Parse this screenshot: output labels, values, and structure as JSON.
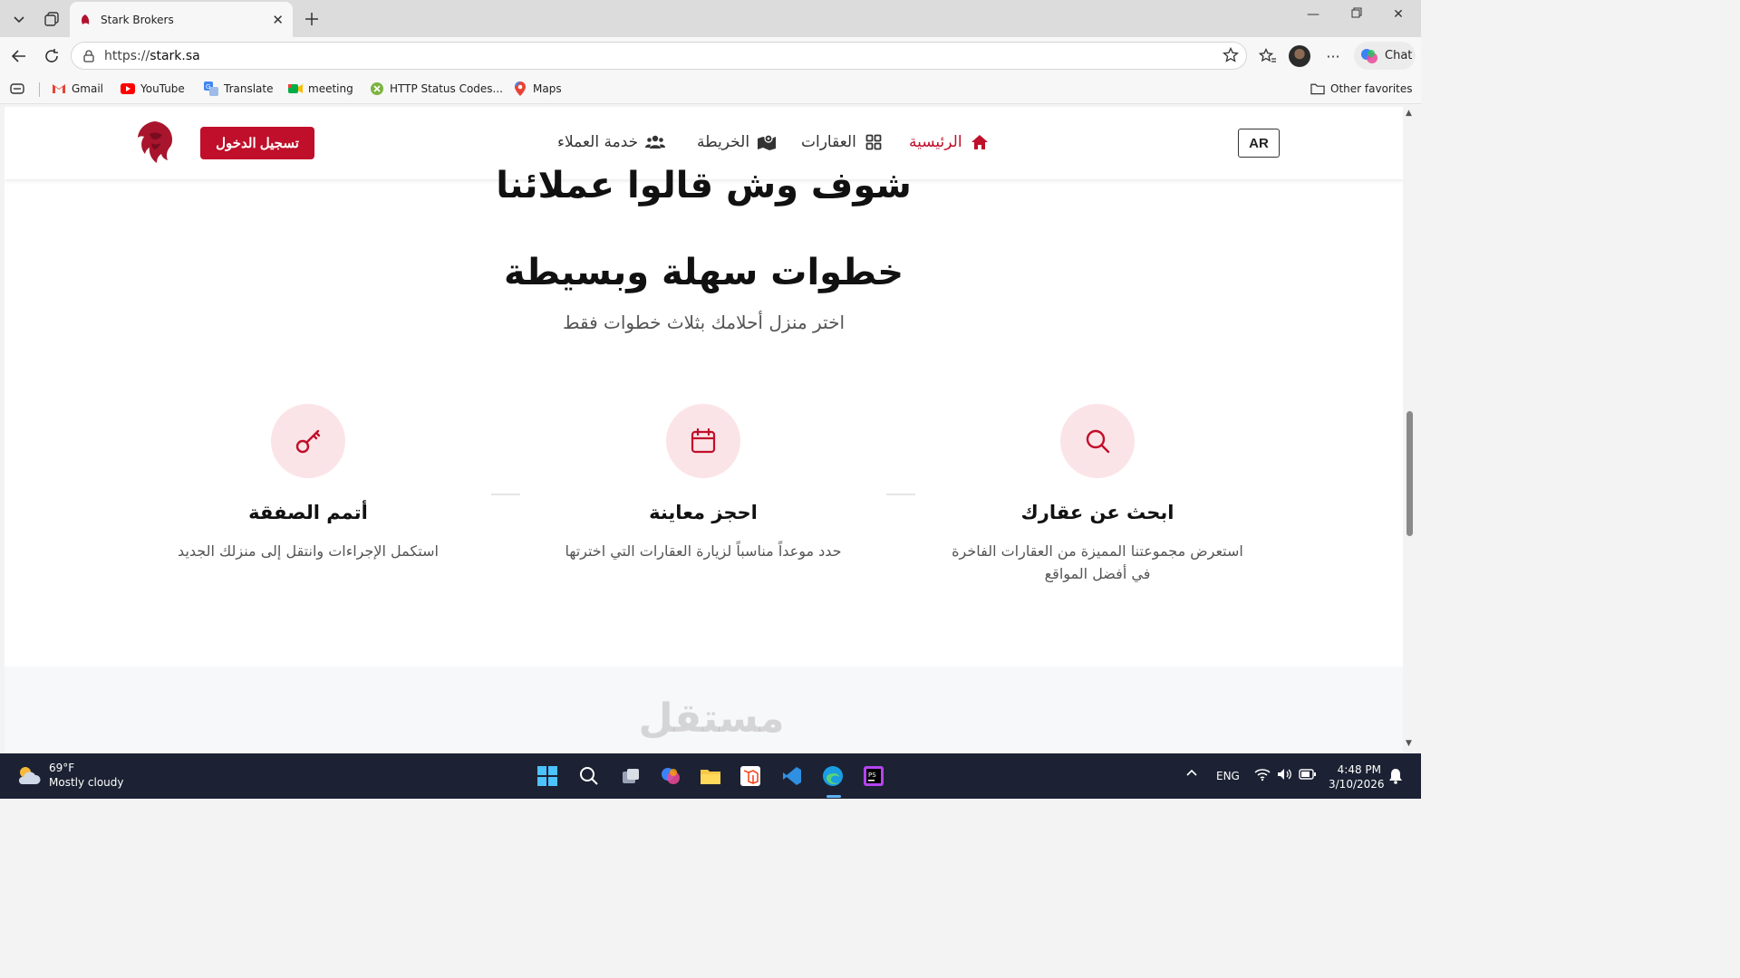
{
  "browser": {
    "tab_title": "Stark Brokers",
    "url_prefix": "https://",
    "url_host": "stark.sa",
    "chat_label": "Chat",
    "favorites": [
      {
        "label": "Gmail",
        "icon": "gmail-icon"
      },
      {
        "label": "YouTube",
        "icon": "youtube-icon"
      },
      {
        "label": "Translate",
        "icon": "translate-icon"
      },
      {
        "label": "meeting",
        "icon": "meet-icon"
      },
      {
        "label": "HTTP Status Codes...",
        "icon": "http-icon"
      },
      {
        "label": "Maps",
        "icon": "maps-icon"
      }
    ],
    "other_favorites": "Other favorites"
  },
  "site": {
    "brand_color": "#c00f2a",
    "login_button": "تسجيل الدخول",
    "nav": {
      "home": "الرئيسية",
      "properties": "العقارات",
      "map": "الخريطة",
      "customer_service": "خدمة العملاء"
    },
    "lang_button": "AR"
  },
  "steps_section": {
    "title": "خطوات سهلة وبسيطة",
    "subtitle": "اختر منزل أحلامك بثلاث خطوات فقط",
    "steps": [
      {
        "title": "ابحث عن عقارك",
        "desc": "استعرض مجموعتنا المميزة من العقارات الفاخرة في أفضل المواقع",
        "icon": "search-icon"
      },
      {
        "title": "احجز معاينة",
        "desc": "حدد موعداً مناسباً لزيارة العقارات التي اخترتها",
        "icon": "calendar-icon"
      },
      {
        "title": "أتمم الصفقة",
        "desc": "استكمل الإجراءات وانتقل إلى منزلك الجديد",
        "icon": "key-icon"
      }
    ]
  },
  "next_section": {
    "title": "شوف وش قالوا عملائنا"
  },
  "watermark": "مستقل",
  "taskbar": {
    "temperature": "69°F",
    "weather": "Mostly cloudy",
    "language": "ENG",
    "time": "4:48 PM",
    "date": "3/10/2026"
  }
}
